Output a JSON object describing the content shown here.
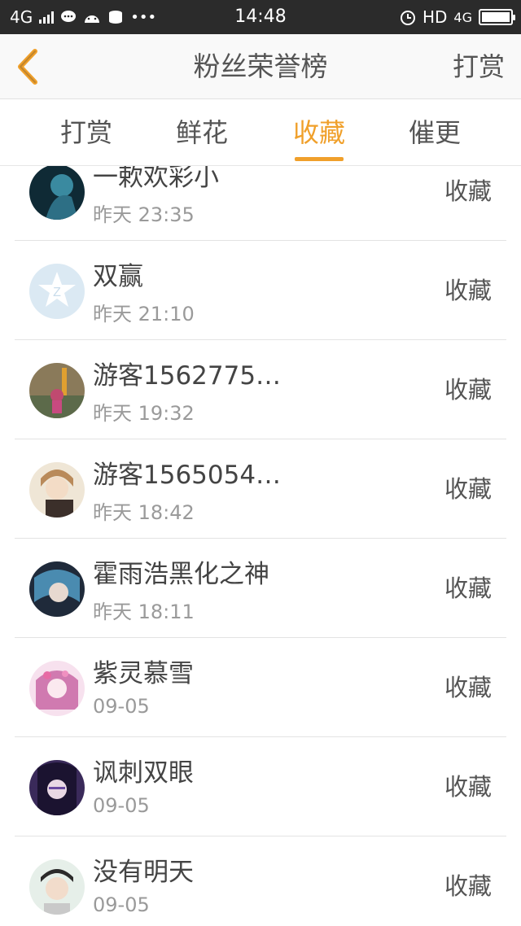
{
  "status_bar": {
    "network": "4G",
    "time": "14:48",
    "hd": "HD",
    "network_right": "4G",
    "more": "•••"
  },
  "header": {
    "title": "粉丝荣誉榜",
    "action": "打赏",
    "back_icon": "chevron-left-icon",
    "accent_color": "#f0a02b"
  },
  "tabs": [
    {
      "label": "打赏",
      "active": false
    },
    {
      "label": "鲜花",
      "active": false
    },
    {
      "label": "收藏",
      "active": true
    },
    {
      "label": "催更",
      "active": false
    }
  ],
  "list": [
    {
      "name": "一欶欢彩小",
      "time": "昨天 23:35",
      "action": "收藏"
    },
    {
      "name": "双赢",
      "time": "昨天 21:10",
      "action": "收藏"
    },
    {
      "name": "游客1562775…",
      "time": "昨天 19:32",
      "action": "收藏"
    },
    {
      "name": "游客1565054…",
      "time": "昨天 18:42",
      "action": "收藏"
    },
    {
      "name": "霍雨浩黑化之神",
      "time": "昨天 18:11",
      "action": "收藏"
    },
    {
      "name": "紫灵慕雪",
      "time": "09-05",
      "action": "收藏"
    },
    {
      "name": "讽刺双眼",
      "time": "09-05",
      "action": "收藏"
    },
    {
      "name": "没有明天",
      "time": "09-05",
      "action": "收藏"
    }
  ]
}
